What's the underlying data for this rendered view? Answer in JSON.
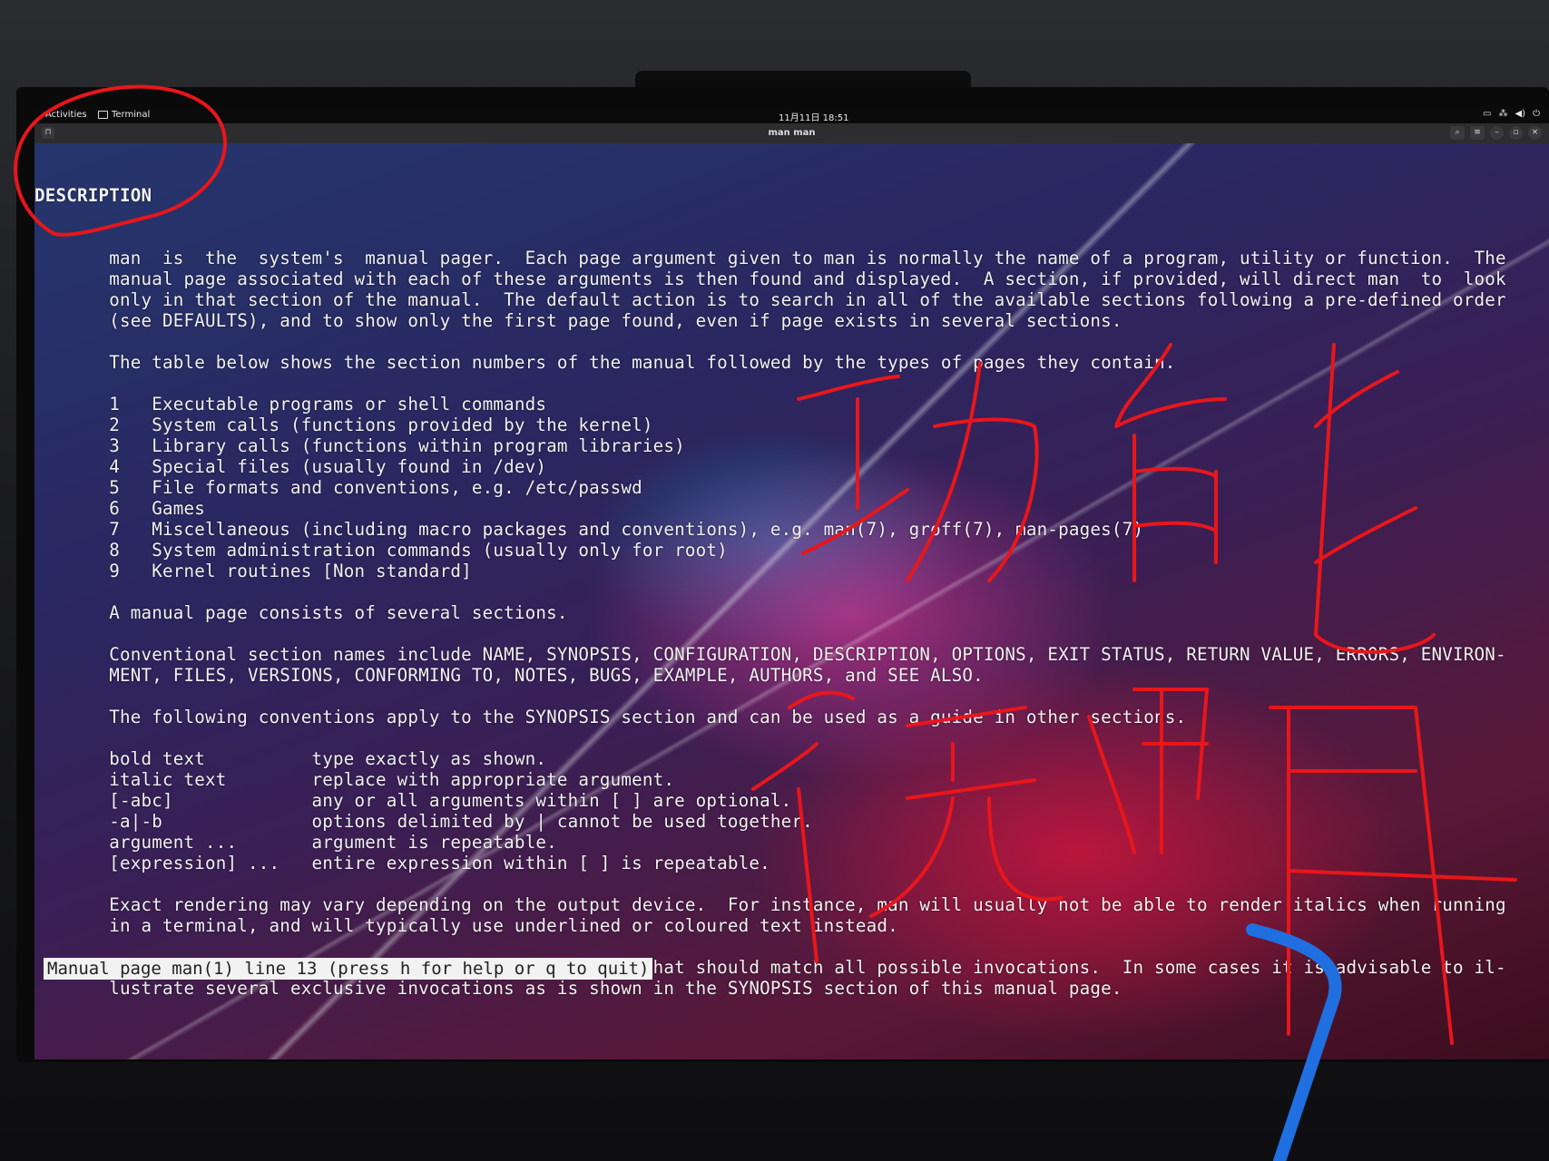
{
  "topbar": {
    "activities": "Activities",
    "app_name": "Terminal",
    "clock": "11月11日 18:51"
  },
  "window": {
    "title": "man man"
  },
  "man": {
    "heading": "DESCRIPTION",
    "lines": [
      "       man  is  the  system's  manual pager.  Each page argument given to man is normally the name of a program, utility or function.  The",
      "       manual page associated with each of these arguments is then found and displayed.  A section, if provided, will direct man  to  look",
      "       only in that section of the manual.  The default action is to search in all of the available sections following a pre-defined order",
      "       (see DEFAULTS), and to show only the first page found, even if page exists in several sections.",
      "",
      "       The table below shows the section numbers of the manual followed by the types of pages they contain.",
      "",
      "       1   Executable programs or shell commands",
      "       2   System calls (functions provided by the kernel)",
      "       3   Library calls (functions within program libraries)",
      "       4   Special files (usually found in /dev)",
      "       5   File formats and conventions, e.g. /etc/passwd",
      "       6   Games",
      "       7   Miscellaneous (including macro packages and conventions), e.g. man(7), groff(7), man-pages(7)",
      "       8   System administration commands (usually only for root)",
      "       9   Kernel routines [Non standard]",
      "",
      "       A manual page consists of several sections.",
      "",
      "       Conventional section names include NAME, SYNOPSIS, CONFIGURATION, DESCRIPTION, OPTIONS, EXIT STATUS, RETURN VALUE, ERRORS, ENVIRON‐",
      "       MENT, FILES, VERSIONS, CONFORMING TO, NOTES, BUGS, EXAMPLE, AUTHORS, and SEE ALSO.",
      "",
      "       The following conventions apply to the SYNOPSIS section and can be used as a guide in other sections.",
      "",
      "       bold text          type exactly as shown.",
      "       italic text        replace with appropriate argument.",
      "       [-abc]             any or all arguments within [ ] are optional.",
      "       -a|-b              options delimited by | cannot be used together.",
      "       argument ...       argument is repeatable.",
      "       [expression] ...   entire expression within [ ] is repeatable.",
      "",
      "       Exact rendering may vary depending on the output device.  For instance, man will usually not be able to render italics when running",
      "       in a terminal, and will typically use underlined or coloured text instead.",
      "",
      "       The command or function illustration is a pattern that should match all possible invocations.  In some cases it is advisable to il‐",
      "       lustrate several exclusive invocations as is shown in the SYNOPSIS section of this manual page."
    ]
  },
  "status_line": "Manual page man(1) line 13 (press h for help or q to quit)",
  "icons": {
    "new_tab": "new-tab-icon",
    "search": "search-icon",
    "menu": "hamburger-menu-icon",
    "minimize": "minimize-icon",
    "maximize": "maximize-icon",
    "close": "close-icon"
  },
  "annotations": {
    "handwritten_text": "功能说明",
    "circle_color": "#e8161b",
    "stroke_color": "#e8161b",
    "pen_blue": "#1f6fe0"
  }
}
